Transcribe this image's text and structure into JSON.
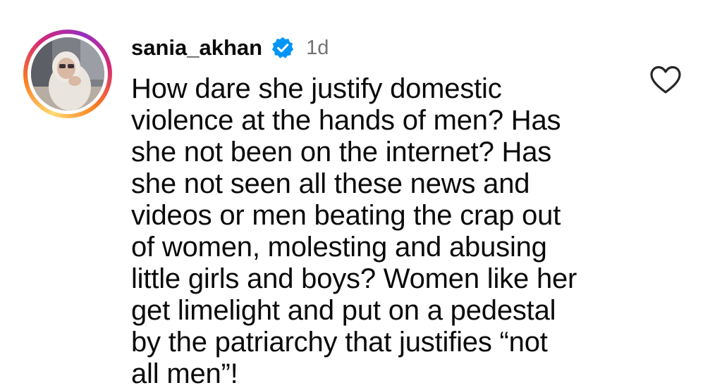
{
  "comment": {
    "username": "sania_akhan",
    "verified": true,
    "timestamp": "1d",
    "text": "How dare she justify domestic\nviolence at the hands of men? Has\nshe not been on the internet? Has\nshe not seen all these news and\nvideos or men beating the crap out\nof women, molesting and abusing\nlittle girls and boys? Women like her\nget limelight and put on a pedestal\nby the patriarchy that justifies “not\nall men”!",
    "avatar_icon": "profile-photo",
    "verified_icon": "verified-badge-icon",
    "like_icon": "heart-outline-icon"
  },
  "colors": {
    "verified_blue": "#0095f6",
    "timestamp_gray": "#737373",
    "text": "#0a0a0a",
    "story_ring": [
      "#feda75",
      "#fa7e1e",
      "#d62976",
      "#962fbf"
    ]
  }
}
